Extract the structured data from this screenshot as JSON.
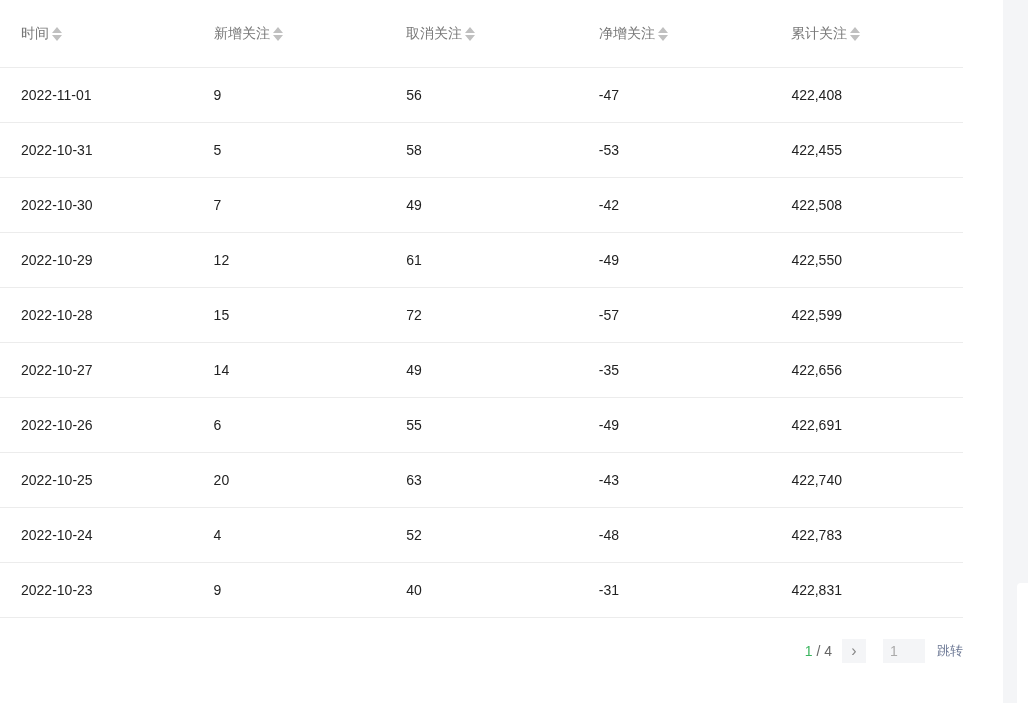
{
  "table": {
    "columns": [
      "时间",
      "新增关注",
      "取消关注",
      "净增关注",
      "累计关注"
    ],
    "rows": [
      [
        "2022-11-01",
        "9",
        "56",
        "-47",
        "422,408"
      ],
      [
        "2022-10-31",
        "5",
        "58",
        "-53",
        "422,455"
      ],
      [
        "2022-10-30",
        "7",
        "49",
        "-42",
        "422,508"
      ],
      [
        "2022-10-29",
        "12",
        "61",
        "-49",
        "422,550"
      ],
      [
        "2022-10-28",
        "15",
        "72",
        "-57",
        "422,599"
      ],
      [
        "2022-10-27",
        "14",
        "49",
        "-35",
        "422,656"
      ],
      [
        "2022-10-26",
        "6",
        "55",
        "-49",
        "422,691"
      ],
      [
        "2022-10-25",
        "20",
        "63",
        "-43",
        "422,740"
      ],
      [
        "2022-10-24",
        "4",
        "52",
        "-48",
        "422,783"
      ],
      [
        "2022-10-23",
        "9",
        "40",
        "-31",
        "422,831"
      ]
    ]
  },
  "pagination": {
    "current": "1",
    "total": "/ 4",
    "next": "›",
    "jump_value": "1",
    "jump_label": "跳转"
  }
}
